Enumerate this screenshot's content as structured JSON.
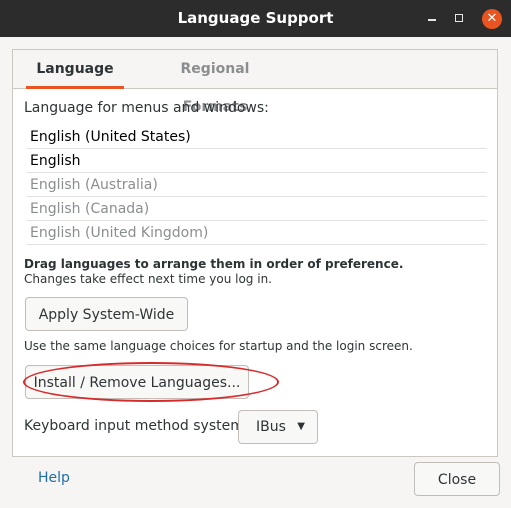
{
  "window": {
    "title": "Language Support"
  },
  "tabs": [
    {
      "label": "Language",
      "active": true
    },
    {
      "label": "Regional Formats",
      "active": false
    }
  ],
  "language_tab": {
    "list_label": "Language for menus and windows:",
    "languages": [
      {
        "name": "English (United States)",
        "style": "dark"
      },
      {
        "name": "English",
        "style": "dark"
      },
      {
        "name": "English (Australia)",
        "style": "gray"
      },
      {
        "name": "English (Canada)",
        "style": "gray"
      },
      {
        "name": "English (United Kingdom)",
        "style": "gray"
      }
    ],
    "drag_hint": "Drag languages to arrange them in order of preference.",
    "change_hint": "Changes take effect next time you log in.",
    "apply_button": "Apply System-Wide",
    "apply_hint": "Use the same language choices for startup and the login screen.",
    "install_button": "Install / Remove Languages...",
    "keyboard_label": "Keyboard input method system:",
    "keyboard_value": "IBus"
  },
  "footer": {
    "help": "Help",
    "close": "Close"
  },
  "colors": {
    "accent": "#e95420",
    "annotation": "#d62b2b",
    "link": "#1f6eaa"
  },
  "icons": {
    "minimize": "minimize-icon",
    "maximize": "maximize-icon",
    "close": "close-icon",
    "dropdown": "chevron-down-icon"
  }
}
